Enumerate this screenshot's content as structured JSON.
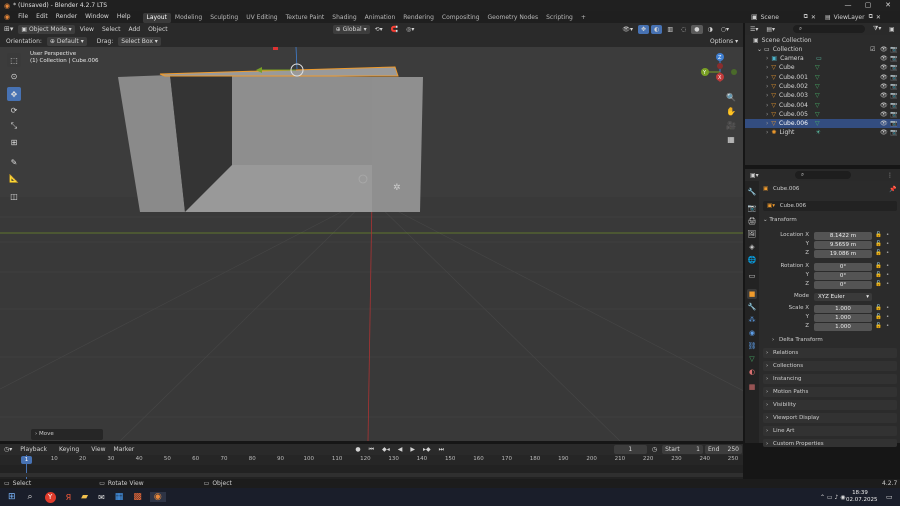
{
  "window": {
    "title": "* (Unsaved) - Blender 4.2.7 LTS",
    "min": "—",
    "max": "▢",
    "close": "✕"
  },
  "menu": [
    "File",
    "Edit",
    "Render",
    "Window",
    "Help"
  ],
  "workspaces": [
    "Layout",
    "Modeling",
    "Sculpting",
    "UV Editing",
    "Texture Paint",
    "Shading",
    "Animation",
    "Rendering",
    "Compositing",
    "Geometry Nodes",
    "Scripting"
  ],
  "workspace_add": "+",
  "scene": {
    "label": "Scene",
    "view_layer": "ViewLayer"
  },
  "viewport_header": {
    "mode": "Object Mode",
    "view": "View",
    "select": "Select",
    "add": "Add",
    "object": "Object",
    "transform": "Global",
    "options": "Options"
  },
  "tool_header": {
    "orientation_label": "Orientation:",
    "orientation_value": "Default",
    "drag_label": "Drag:",
    "drag_value": "Select Box"
  },
  "viewport_info": {
    "line1": "User Perspective",
    "line2": "(1) Collection | Cube.006"
  },
  "gizmo": {
    "x": "X",
    "y": "Y",
    "z": "Z"
  },
  "last_op": "Move",
  "timeline_header": {
    "playback": "Playback",
    "keying": "Keying",
    "view": "View",
    "marker": "Marker",
    "current_frame": "1",
    "start_label": "Start",
    "start": "1",
    "end_label": "End",
    "end": "250"
  },
  "timeline_ticks": [
    "0",
    "10",
    "20",
    "30",
    "40",
    "50",
    "60",
    "70",
    "80",
    "90",
    "100",
    "110",
    "120",
    "130",
    "140",
    "150",
    "160",
    "170",
    "180",
    "190",
    "200",
    "210",
    "220",
    "230",
    "240",
    "250"
  ],
  "current_frame_marker": "1",
  "statusbar": {
    "select": "Select",
    "rotate": "Rotate View",
    "object": "Object",
    "version": "4.2.7"
  },
  "outliner": {
    "search_placeholder": "",
    "scene_collection": "Scene Collection",
    "collection": "Collection",
    "items": [
      {
        "name": "Camera",
        "type": "camera"
      },
      {
        "name": "Cube",
        "type": "mesh"
      },
      {
        "name": "Cube.001",
        "type": "mesh"
      },
      {
        "name": "Cube.002",
        "type": "mesh"
      },
      {
        "name": "Cube.003",
        "type": "mesh"
      },
      {
        "name": "Cube.004",
        "type": "mesh"
      },
      {
        "name": "Cube.005",
        "type": "mesh"
      },
      {
        "name": "Cube.006",
        "type": "mesh",
        "selected": true
      },
      {
        "name": "Light",
        "type": "light"
      }
    ]
  },
  "properties": {
    "object_name": "Cube.006",
    "object_name_field": "Cube.006",
    "transform": "Transform",
    "location_label": "Location X",
    "location": [
      "8.1422 m",
      "9.5659 m",
      "19.086 m"
    ],
    "rotation_label": "Rotation X",
    "rotation": [
      "0°",
      "0°",
      "0°"
    ],
    "mode_label": "Mode",
    "mode_value": "XYZ Euler",
    "scale_label": "Scale X",
    "scale": [
      "1.000",
      "1.000",
      "1.000"
    ],
    "axis_y": "Y",
    "axis_z": "Z",
    "panels": [
      "Delta Transform",
      "Relations",
      "Collections",
      "Instancing",
      "Motion Paths",
      "Visibility",
      "Viewport Display",
      "Line Art",
      "Custom Properties"
    ]
  },
  "taskbar": {
    "time": "18:39",
    "date": "02.07.2025"
  },
  "colors": {
    "accent": "#4772b3",
    "selection": "#334d80",
    "x_axis": "#c23a3a",
    "y_axis": "#7aa025",
    "z_axis": "#3f7fd1",
    "select_outline": "#f09b2c"
  }
}
